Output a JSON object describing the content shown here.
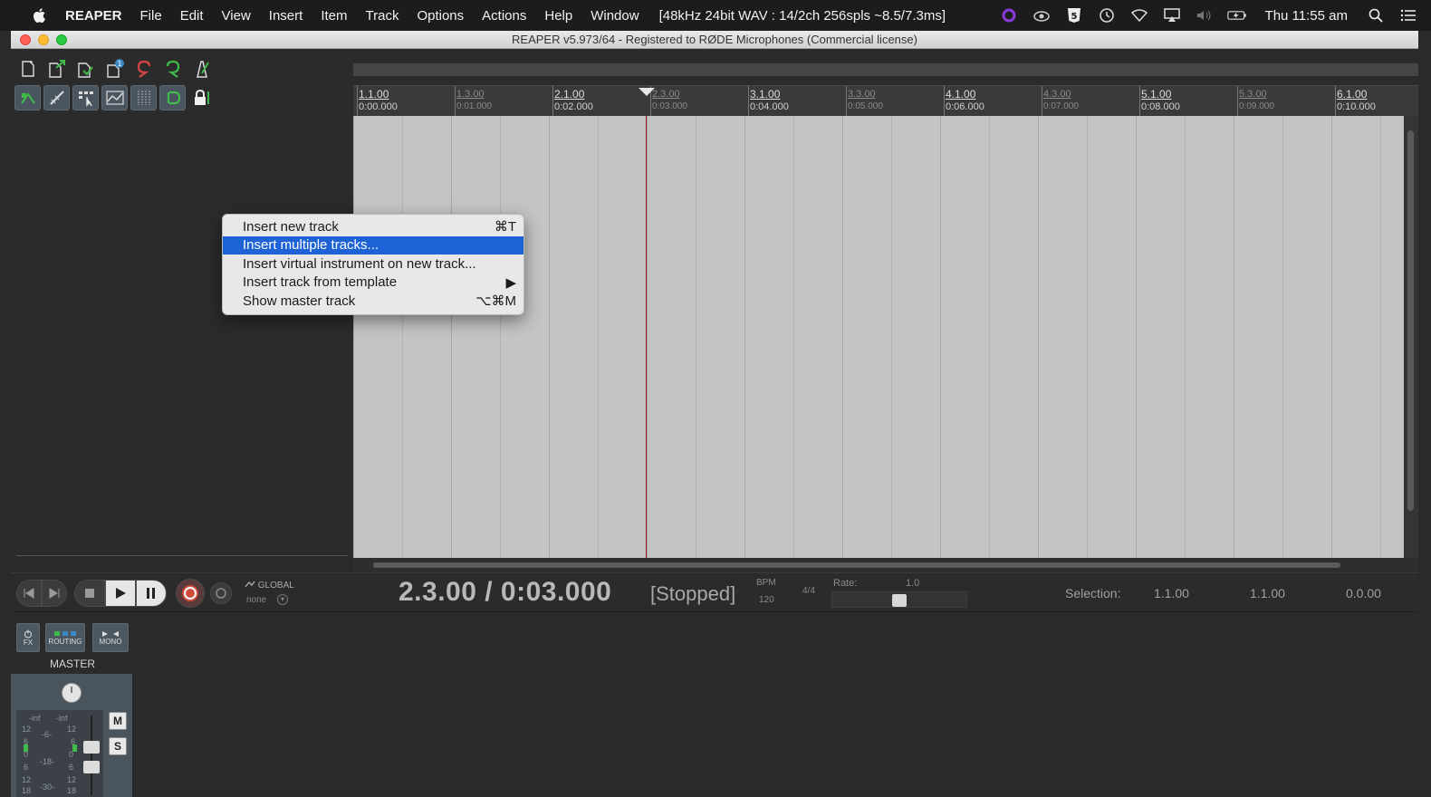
{
  "menubar": {
    "app_name": "REAPER",
    "items": [
      "File",
      "Edit",
      "View",
      "Insert",
      "Item",
      "Track",
      "Options",
      "Actions",
      "Help",
      "Window"
    ],
    "audio_status": "[48kHz 24bit WAV : 14/2ch 256spls ~8.5/7.3ms]",
    "clock": "Thu 11:55 am",
    "status_icons": [
      "purple-circle-icon",
      "cloud-icon",
      "html5-shield-icon",
      "time-machine-icon",
      "wifi-icon",
      "airplay-icon",
      "volume-icon",
      "battery-icon",
      "spotlight-search-icon",
      "notification-list-icon"
    ]
  },
  "window": {
    "title": "REAPER v5.973/64 - Registered to RØDE Microphones (Commercial license)"
  },
  "toolbar": {
    "row1": [
      "new-project-icon",
      "open-project-icon",
      "save-project-icon",
      "project-settings-icon",
      "undo-icon",
      "redo-icon",
      "metronome-icon"
    ],
    "row2": [
      "auto-crossfade-icon",
      "ripple-edit-icon",
      "grid-snap-icon",
      "envelope-points-icon",
      "grid-lines-icon",
      "loop-toggle-icon",
      "lock-icon"
    ],
    "badge": "1"
  },
  "ruler": {
    "marks": [
      {
        "bar": "1.1.00",
        "time": "0:00.000",
        "major": true
      },
      {
        "bar": "1.3.00",
        "time": "0:01.000",
        "major": false
      },
      {
        "bar": "2.1.00",
        "time": "0:02.000",
        "major": true
      },
      {
        "bar": "2.3.00",
        "time": "0:03.000",
        "major": false
      },
      {
        "bar": "3.1.00",
        "time": "0:04.000",
        "major": true
      },
      {
        "bar": "3.3.00",
        "time": "0:05.000",
        "major": false
      },
      {
        "bar": "4.1.00",
        "time": "0:06.000",
        "major": true
      },
      {
        "bar": "4.3.00",
        "time": "0:07.000",
        "major": false
      },
      {
        "bar": "5.1.00",
        "time": "0:08.000",
        "major": true
      },
      {
        "bar": "5.3.00",
        "time": "0:09.000",
        "major": false
      },
      {
        "bar": "6.1.00",
        "time": "0:10.000",
        "major": true
      }
    ]
  },
  "context_menu": {
    "items": [
      {
        "label": "Insert new track",
        "shortcut": "⌘T",
        "selected": false
      },
      {
        "label": "Insert multiple tracks...",
        "shortcut": "",
        "selected": true
      },
      {
        "label": "Insert virtual instrument on new track...",
        "shortcut": "",
        "selected": false
      },
      {
        "label": "Insert track from template",
        "shortcut": "▶",
        "selected": false
      },
      {
        "label": "Show master track",
        "shortcut": "⌥⌘M",
        "selected": false
      }
    ]
  },
  "transport": {
    "automation_mode_label": "GLOBAL",
    "automation_mode_value": "none",
    "position": "2.3.00 / 0:03.000",
    "state": "[Stopped]",
    "bpm_label": "BPM",
    "bpm_value": "120",
    "time_signature": "4/4",
    "rate_label": "Rate:",
    "rate_value": "1.0",
    "selection_label": "Selection:",
    "selection_start": "1.1.00",
    "selection_end": "1.1.00",
    "selection_length": "0.0.00"
  },
  "master": {
    "label": "MASTER",
    "fx_label": "FX",
    "routing_label": "ROUTING",
    "mono_label": "MONO",
    "mute_label": "M",
    "solo_label": "S",
    "meter_peaks": [
      "-inf",
      "-inf"
    ],
    "meter_scale_left": [
      "12",
      "6",
      "0",
      "6",
      "12",
      "18"
    ],
    "meter_scale_mid": [
      "-6-",
      "-18-",
      "-30-"
    ],
    "meter_scale_right": [
      "12",
      "6",
      "0",
      "6",
      "12",
      "18"
    ]
  }
}
